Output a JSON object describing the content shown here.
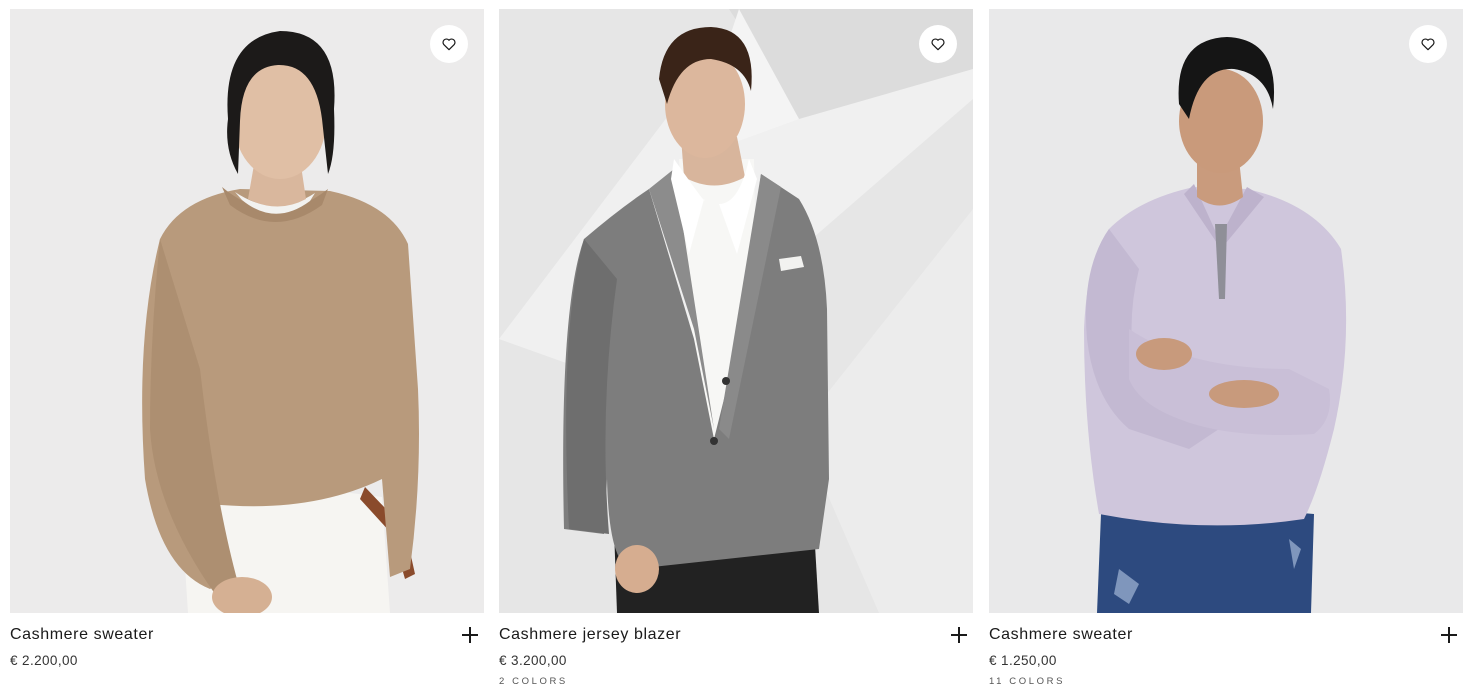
{
  "products": [
    {
      "name": "Cashmere sweater",
      "price": "€ 2.200,00",
      "colors": "",
      "image_alt": "Cashmere sweater",
      "bg": "#ecebeb"
    },
    {
      "name": "Cashmere jersey blazer",
      "price": "€ 3.200,00",
      "colors": "2 colors",
      "image_alt": "Cashmere jersey blazer",
      "bg": "#e6e6e6"
    },
    {
      "name": "Cashmere sweater",
      "price": "€ 1.250,00",
      "colors": "11 colors",
      "image_alt": "Cashmere sweater",
      "bg": "#e9e9ea"
    }
  ],
  "icons": {
    "wishlist": "heart-icon",
    "quick_add": "plus-icon"
  }
}
